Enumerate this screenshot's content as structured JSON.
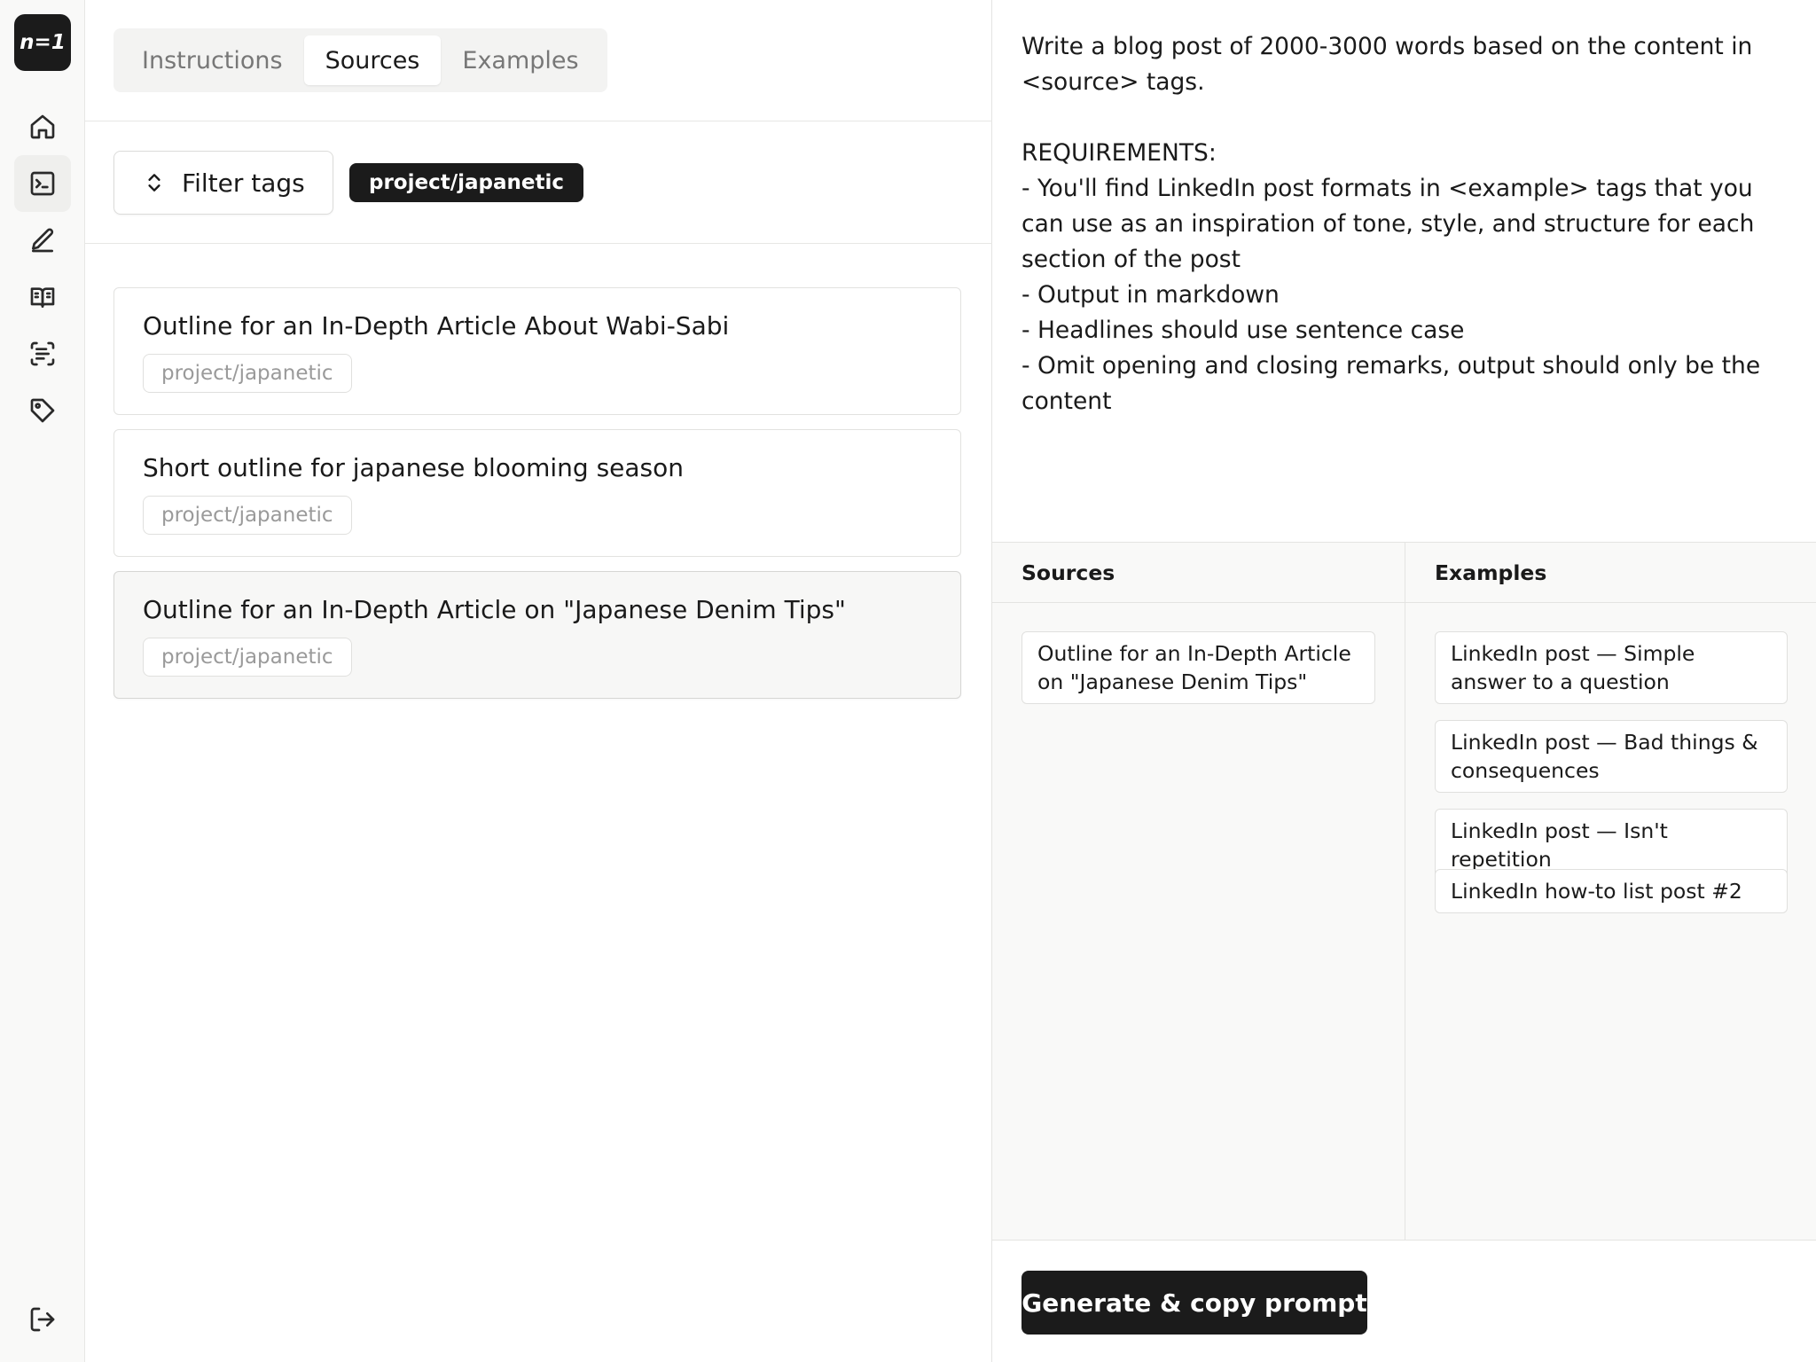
{
  "logo": {
    "text": "n=1"
  },
  "rail": {
    "items": [
      {
        "icon": "home-icon",
        "active": false
      },
      {
        "icon": "terminal-icon",
        "active": true
      },
      {
        "icon": "pencil-icon",
        "active": false
      },
      {
        "icon": "book-icon",
        "active": false
      },
      {
        "icon": "scan-text-icon",
        "active": false
      },
      {
        "icon": "tag-icon",
        "active": false
      }
    ],
    "bottom_icon": "logout-icon"
  },
  "tabs": [
    {
      "label": "Instructions",
      "selected": false
    },
    {
      "label": "Sources",
      "selected": true
    },
    {
      "label": "Examples",
      "selected": false
    }
  ],
  "filter": {
    "button_label": "Filter tags",
    "active_tag": "project/japanetic"
  },
  "sources": [
    {
      "title": "Outline for an In-Depth Article About Wabi-Sabi",
      "tag": "project/japanetic"
    },
    {
      "title": "Short outline for japanese blooming season",
      "tag": "project/japanetic"
    },
    {
      "title": "Outline for an In-Depth Article on \"Japanese Denim Tips\"",
      "tag": "project/japanetic"
    }
  ],
  "prompt": {
    "text": "Write a blog post of 2000-3000 words based on the content in\n<source> tags.\n\nREQUIREMENTS:\n- You'll find LinkedIn post formats in <example> tags that you\ncan use as an inspiration of tone, style, and structure for each\nsection of the post\n- Output in markdown\n- Headlines should use sentence case\n- Omit opening and closing remarks, output should only be the\ncontent"
  },
  "selected": {
    "sources_header": "Sources",
    "examples_header": "Examples",
    "sources": [
      "Outline for an In-Depth Article on \"Japanese Denim Tips\""
    ],
    "examples": [
      "LinkedIn post — Simple answer to a question",
      "LinkedIn post — Bad things & consequences",
      "LinkedIn post — Isn't repetition",
      "LinkedIn how-to list post #2"
    ]
  },
  "actions": {
    "generate_label": "Generate & copy prompt"
  }
}
